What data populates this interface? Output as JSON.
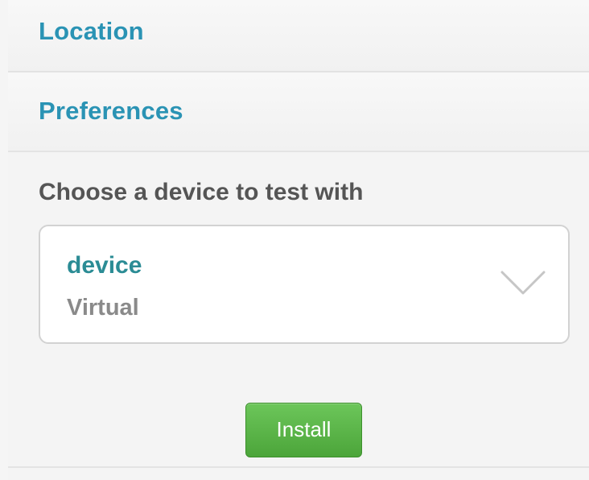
{
  "sections": {
    "location_label": "Location",
    "preferences_label": "Preferences"
  },
  "device_chooser": {
    "prompt": "Choose a device to test with",
    "selected_name": "device",
    "selected_type": "Virtual",
    "dropdown_icon": "chevron-down-icon"
  },
  "actions": {
    "install_label": "Install"
  },
  "colors": {
    "section_title": "#2a93b4",
    "device_name": "#2b8c95",
    "install_button": "#5bb548"
  }
}
